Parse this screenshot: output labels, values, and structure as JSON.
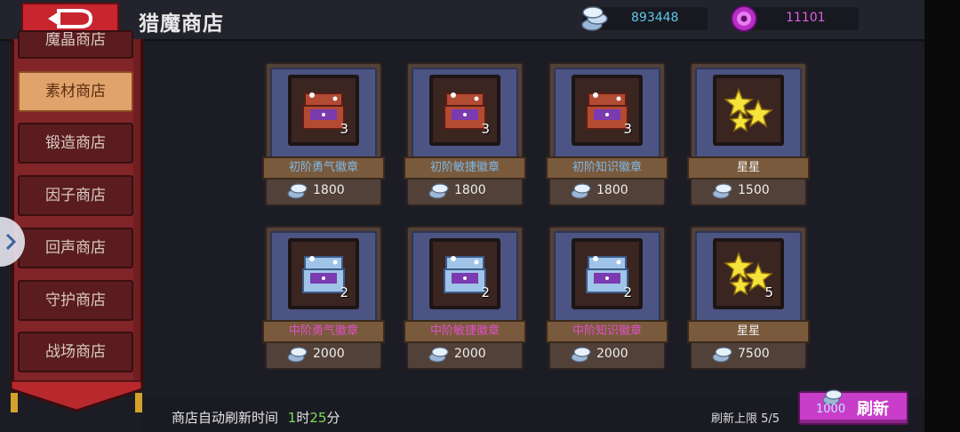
{
  "header": {
    "title": "猎魔商店",
    "silver_amount": "893448",
    "gem_amount": "11101"
  },
  "sidebar": {
    "items": [
      {
        "label": "魔晶商店"
      },
      {
        "label": "素材商店"
      },
      {
        "label": "锻造商店"
      },
      {
        "label": "因子商店"
      },
      {
        "label": "回声商店"
      },
      {
        "label": "守护商店"
      },
      {
        "label": "战场商店"
      }
    ],
    "active_index": 1
  },
  "shop": {
    "items": [
      {
        "name": "初阶勇气徽章",
        "price": "1800",
        "qty": "3",
        "tier": "basic",
        "icon": "chest-icon"
      },
      {
        "name": "初阶敏捷徽章",
        "price": "1800",
        "qty": "3",
        "tier": "basic",
        "icon": "chest-icon"
      },
      {
        "name": "初阶知识徽章",
        "price": "1800",
        "qty": "3",
        "tier": "basic",
        "icon": "chest-icon"
      },
      {
        "name": "星星",
        "price": "1500",
        "qty": "",
        "tier": "star",
        "icon": "star-icon"
      },
      {
        "name": "中阶勇气徽章",
        "price": "2000",
        "qty": "2",
        "tier": "mid",
        "icon": "chest-icon"
      },
      {
        "name": "中阶敏捷徽章",
        "price": "2000",
        "qty": "2",
        "tier": "mid",
        "icon": "chest-icon"
      },
      {
        "name": "中阶知识徽章",
        "price": "2000",
        "qty": "2",
        "tier": "mid",
        "icon": "chest-icon"
      },
      {
        "name": "星星",
        "price": "7500",
        "qty": "5",
        "tier": "star",
        "icon": "star-icon"
      }
    ]
  },
  "footer": {
    "refresh_prefix": "商店自动刷新时间",
    "refresh_hours": "1",
    "hours_unit": "时",
    "refresh_minutes": "25",
    "minutes_unit": "分",
    "refresh_limit": "刷新上限 5/5",
    "refresh_cost": "1000",
    "refresh_label": "刷新"
  },
  "colors": {
    "silver_text": "#5fc6e8",
    "gem_text": "#e060e0",
    "basic_label": "#7fb8e8",
    "mid_label": "#e050c8",
    "star_label": "#f2f2f2",
    "time_highlight": "#7ddc5a",
    "accent_red": "#c8252f",
    "accent_purple": "#c83ec8"
  }
}
